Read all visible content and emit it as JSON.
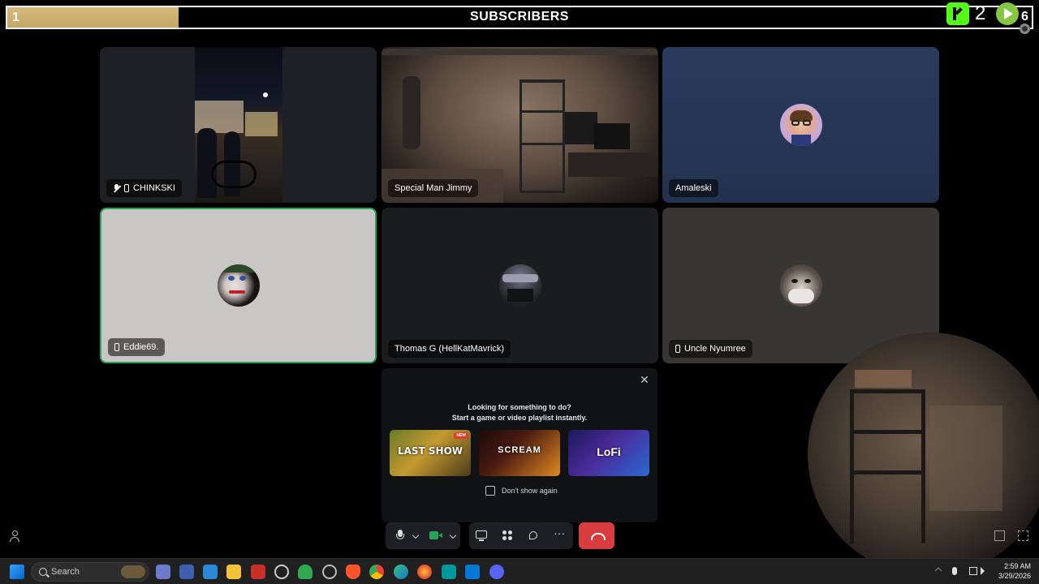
{
  "overlay": {
    "subscriber_count": "1",
    "subscriber_goal_progress": 0.167,
    "title": "SUBSCRIBERS",
    "kick_count": "2",
    "rumble_count": "6",
    "icons": [
      "kick-icon",
      "rumble-icon",
      "settings-icon"
    ]
  },
  "participants": [
    {
      "name": "CHINKSKI",
      "mobile": true,
      "muted": true
    },
    {
      "name": "Special Man Jimmy",
      "mobile": false,
      "muted": false
    },
    {
      "name": "Amaleski",
      "mobile": false,
      "muted": false
    },
    {
      "name": "Eddie69.",
      "mobile": true,
      "muted": false,
      "speaking": true
    },
    {
      "name": "Thomas G (HellKatMavrick)",
      "mobile": false,
      "muted": false
    },
    {
      "name": "Uncle Nyumree",
      "mobile": true,
      "muted": false
    }
  ],
  "activity": {
    "line1": "Looking for something to do?",
    "line2": "Start a game or video playlist instantly.",
    "cards": [
      {
        "title": "LAST SHOW",
        "badge": "NEW"
      },
      {
        "title": "SCREAM",
        "badge": ""
      },
      {
        "title": "LoFi",
        "badge": ""
      }
    ],
    "dont_show_label": "Don't show again"
  },
  "taskbar": {
    "search_placeholder": "Search",
    "time": "2:59 AM",
    "date": "3/29/2026",
    "colors": {
      "accent": "#0078d4",
      "discord": "#5865f2",
      "hangup": "#d83c3e",
      "speaking": "#23a55a"
    }
  }
}
